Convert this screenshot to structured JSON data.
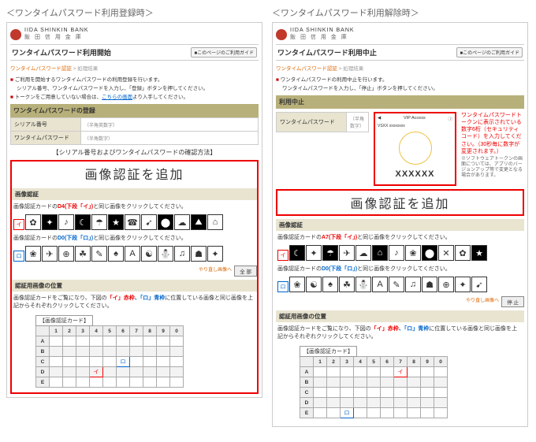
{
  "left": {
    "heading": "＜ワンタイムパスワード利用登録時＞",
    "bank_en": "IIDA SHINKIN BANK",
    "bank_jp": "飯 田 信 用 金 庫",
    "page_title": "ワンタイムパスワード利用開始",
    "help": "■このページのご利用ガイド",
    "breadcrumb_a": "ワンタイムパスワード認証",
    "breadcrumb_b": "処理結果",
    "note1": "ご利用を開始するワンタイムパスワードの利用登録を行います。",
    "note2": "シリアル番号、ワンタイムパスワードを入力し、「登録」ボタンを押してください。",
    "note3_a": "トークンをご用意していない場合は、",
    "note3_link": "こちらの画面",
    "note3_b": "より入手してください。",
    "section_register": "ワンタイムパスワードの登録",
    "field_serial": "シリアル番号",
    "field_otp": "ワンタイムパスワード",
    "hint_han": "（半角英数字）",
    "hint_num": "（半角数字）",
    "confirm_note": "【シリアル番号およびワンタイムパスワードの確認方法】",
    "add_banner": "画像認証を追加",
    "sub_img": "画像認証",
    "inst_a_pre": "画像認証カードの",
    "inst_a_mark": "D4(下段「イ」)",
    "inst_a_post": "と同じ画像をクリックしてください。",
    "inst_b_pre": "画像認証カードの",
    "inst_b_mark": "D0(下段「ロ」)",
    "inst_b_post": "と同じ画像をクリックしてください。",
    "btn_redo": "やり直し画像へ",
    "btn_all": "全 部",
    "sub_pos": "認証用画像の位置",
    "pos_note_pre": "画像認証カードをご覧になり、下図の",
    "pos_note_i": "「イ」赤枠",
    "pos_note_r": "、「ロ」青枠",
    "pos_note_post": "に位置している画像と同じ画像を上記からそれぞれクリックしてください。",
    "grid_label": "【画像認証カード】",
    "grid_cols": [
      "",
      "1",
      "2",
      "3",
      "4",
      "5",
      "6",
      "7",
      "8",
      "9",
      "0"
    ],
    "grid_rows": [
      "A",
      "B",
      "C",
      "D",
      "E"
    ],
    "mark_i_cell": "D4",
    "mark_r_cell": "C6"
  },
  "right": {
    "heading": "＜ワンタイムパスワード利用解除時＞",
    "page_title": "ワンタイムパスワード利用中止",
    "note1": "ワンタイムパスワードの利用中止を行います。",
    "note2": "ワンタイムパスワードを入力し、「停止」ボタンを押してください。",
    "section_stop": "利用中止",
    "field_otp": "ワンタイムパスワード",
    "hint_num": "（半角数字）",
    "phone_app": "VIP Access",
    "phone_serial": "VSXX xxxxxxxx",
    "phone_code": "XXXXXX",
    "callout": "ワンタイムパスワードトークンに表示されている数字6桁（セキュリティコード）を入力してください。（30秒毎に数字が変更されます。）",
    "small_note": "※ソフトウェアトークンの画面については、アプリのバージョンアップ等で変更となる場合があります。",
    "inst_a_pre": "画像認証カードの",
    "inst_a_mark": "A7(下段「イ」)",
    "inst_a_post": "と同じ画像をクリックしてください。",
    "inst_b_pre": "画像認証カードの",
    "inst_b_mark": "D0(下段「ロ」)",
    "inst_b_post": "と同じ画像をクリックしてください。",
    "btn_stop": "停 止",
    "mark_i_cell": "A7",
    "mark_r_cell": "E3"
  }
}
